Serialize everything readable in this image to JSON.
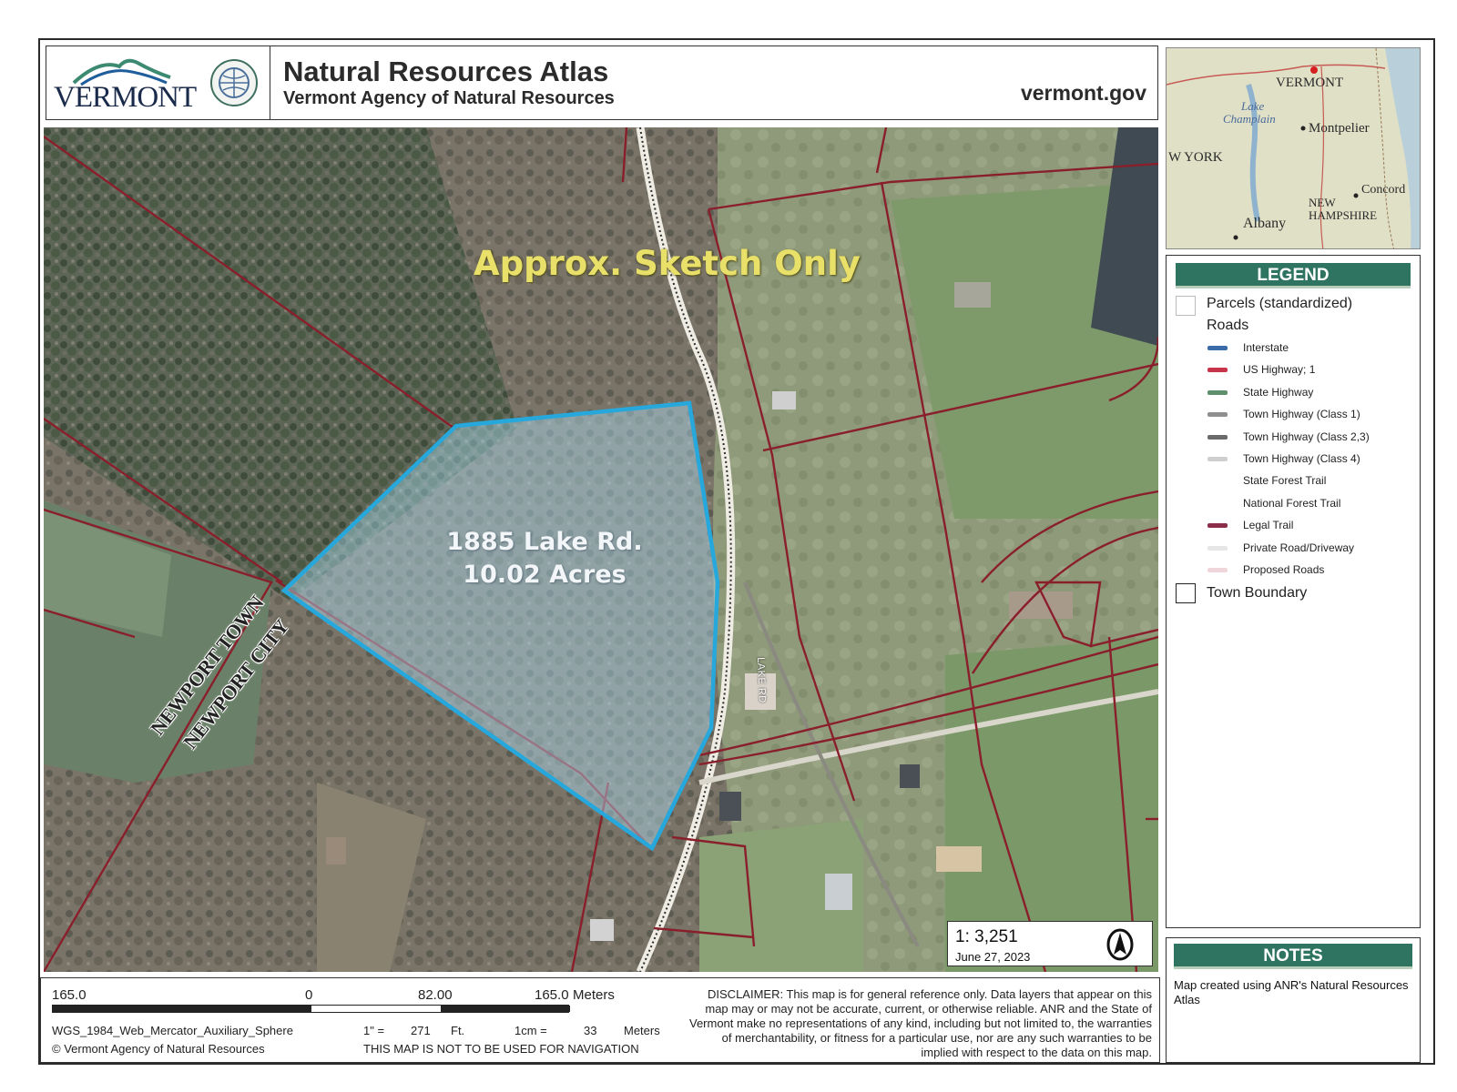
{
  "header": {
    "logo_text": "VERMONT",
    "title": "Natural Resources Atlas",
    "subtitle": "Vermont Agency of Natural Resources",
    "site": "vermont.gov"
  },
  "inset": {
    "labels": [
      "VERMONT",
      "Lake",
      "Champlain",
      "Montpelier",
      "W YORK",
      "Concord",
      "NEW",
      "HAMPSHIRE",
      "Albany"
    ]
  },
  "map": {
    "watermark": "Approx. Sketch Only",
    "parcel_line1": "1885 Lake Rd.",
    "parcel_line2": "10.02 Acres",
    "road_label": "LAKE RD",
    "boundary_upper": "NEWPORT TOWN",
    "boundary_lower": "NEWPORT CITY",
    "scale_ratio": "1:  3,251",
    "date": "June 27, 2023"
  },
  "legend": {
    "title": "LEGEND",
    "parcels": "Parcels (standardized)",
    "roads": "Roads",
    "items": [
      {
        "label": "Interstate",
        "color": "#3d6aa8"
      },
      {
        "label": "US Highway; 1",
        "color": "#c8344a"
      },
      {
        "label": "State Highway",
        "color": "#5f8f6c"
      },
      {
        "label": "Town Highway (Class 1)",
        "color": "#8f8f8f"
      },
      {
        "label": "Town Highway (Class 2,3)",
        "color": "#6a6a6a"
      },
      {
        "label": "Town Highway (Class 4)",
        "color": "#cfcfcf"
      },
      {
        "label": "State Forest Trail",
        "color": "#ffffff"
      },
      {
        "label": "National Forest Trail",
        "color": "#ffffff"
      },
      {
        "label": "Legal Trail",
        "color": "#8b2e4a"
      },
      {
        "label": "Private Road/Driveway",
        "color": "#e6e6e6"
      },
      {
        "label": "Proposed Roads",
        "color": "#f0d6da"
      }
    ],
    "town_boundary": "Town Boundary"
  },
  "notes": {
    "title": "NOTES",
    "text": "Map created using ANR's Natural Resources Atlas"
  },
  "footer": {
    "scale_left": "165.0",
    "scale_zero": "0",
    "scale_mid": "82.00",
    "scale_right": "165.0",
    "scale_units": "Meters",
    "projection": "WGS_1984_Web_Mercator_Auxiliary_Sphere",
    "copyright": "© Vermont Agency of Natural Resources",
    "inch_label": "1\" =",
    "inch_value": "271",
    "inch_units": "Ft.",
    "cm_label": "1cm =",
    "cm_value": "33",
    "cm_units": "Meters",
    "nav_warning": "THIS MAP IS NOT TO BE USED FOR NAVIGATION",
    "disclaimer": "DISCLAIMER: This map is for general reference only. Data layers that appear on this map may or may not be accurate, current, or otherwise reliable. ANR and the State of Vermont make no representations of any kind, including but not limited to, the warranties of merchantability, or fitness for a particular use, nor are any such warranties to be implied with respect to the data on this map."
  }
}
